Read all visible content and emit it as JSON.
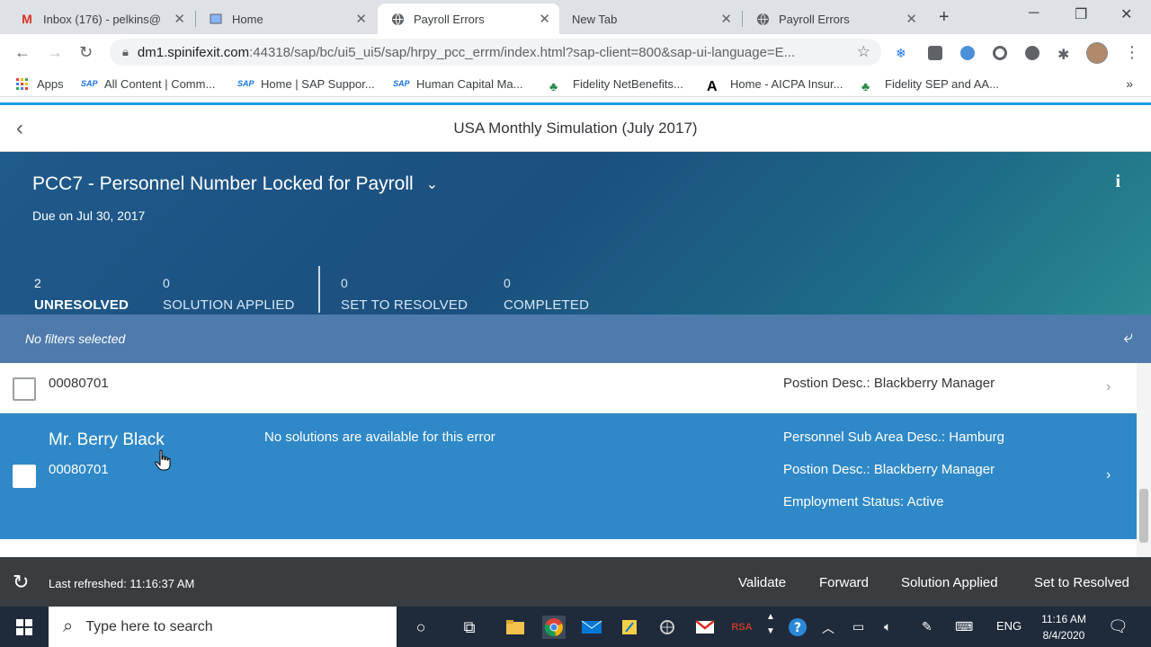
{
  "browser": {
    "tabs": [
      {
        "title": "Inbox (176) - pelkins@",
        "icon": "gmail-icon"
      },
      {
        "title": "Home",
        "icon": "document-icon"
      },
      {
        "title": "Payroll Errors",
        "icon": "globe-icon"
      },
      {
        "title": "New Tab",
        "icon": ""
      },
      {
        "title": "Payroll Errors",
        "icon": "globe-icon"
      }
    ],
    "url_host": "dm1.spinifexit.com",
    "url_path": ":44318/sap/bc/ui5_ui5/sap/hrpy_pcc_errm/index.html?sap-client=800&sap-ui-language=E...",
    "bookmarks": [
      "Apps",
      "All Content | Comm...",
      "Home | SAP Suppor...",
      "Human Capital Ma...",
      "Fidelity NetBenefits...",
      "Home - AICPA Insur...",
      "Fidelity SEP and AA..."
    ],
    "bookmarks_more": "»"
  },
  "app": {
    "title": "USA Monthly Simulation (July 2017)"
  },
  "header": {
    "object_title": "PCC7 - Personnel Number Locked for Payroll",
    "due": "Due on Jul 30, 2017",
    "kpis": [
      {
        "count": "2",
        "label": "UNRESOLVED"
      },
      {
        "count": "0",
        "label": "SOLUTION APPLIED"
      },
      {
        "count": "0",
        "label": "SET TO RESOLVED"
      },
      {
        "count": "0",
        "label": "COMPLETED"
      }
    ]
  },
  "filter": {
    "text": "No filters selected"
  },
  "list": {
    "row1": {
      "pernr": "00080701",
      "position": "Postion Desc.: Blackberry Manager"
    },
    "row2": {
      "name": "Mr. Berry Black",
      "pernr": "00080701",
      "message": "No solutions are available for this error",
      "sub_area": "Personnel Sub Area Desc.: Hamburg",
      "position": "Postion Desc.: Blackberry Manager",
      "status": "Employment Status: Active"
    }
  },
  "footer": {
    "last_refreshed": "Last refreshed: 11:16:37 AM",
    "buttons": [
      "Validate",
      "Forward",
      "Solution Applied",
      "Set to Resolved"
    ]
  },
  "taskbar": {
    "search_placeholder": "Type here to search",
    "lang": "ENG",
    "time": "11:16 AM",
    "date": "8/4/2020"
  },
  "colors": {
    "selected_row": "#2f88c7",
    "filter_bar": "#4e7bac",
    "footer": "#3a3d40"
  }
}
